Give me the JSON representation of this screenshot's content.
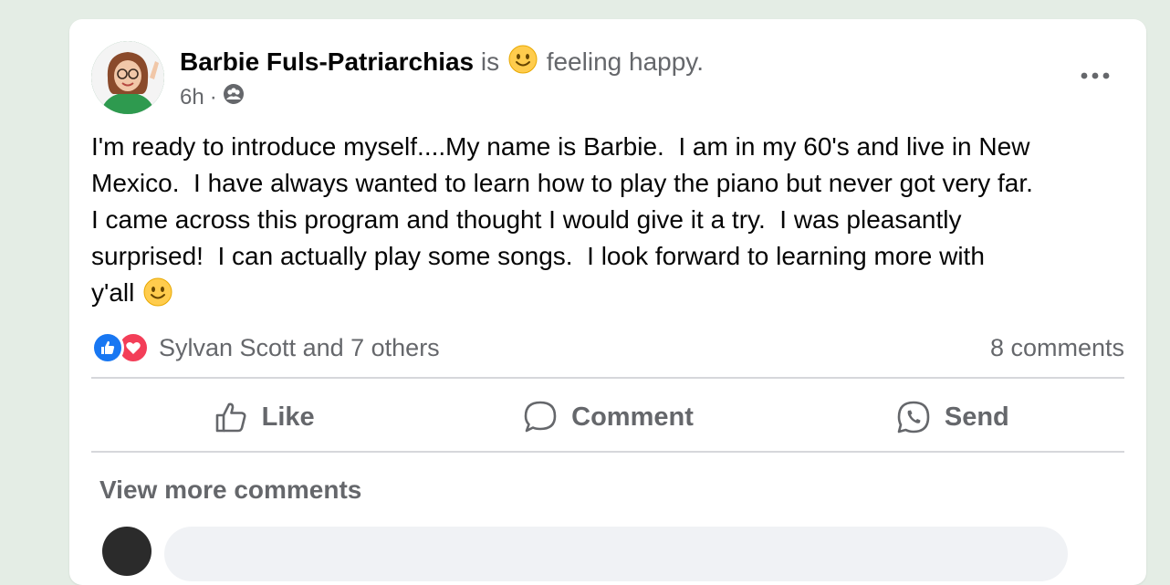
{
  "post": {
    "author": "Barbie Fuls-Patriarchias",
    "feeling_prefix": "is",
    "feeling_text": "feeling happy.",
    "feeling_icon": "smiling-face-icon",
    "timestamp": "6h",
    "separator": "·",
    "audience_icon": "group-icon",
    "body": "I'm ready to introduce myself....My name is Barbie.  I am in my 60's and live in New\nMexico.  I have always wanted to learn how to play the piano but never got very far.\nI came across this program and thought I would give it a try.  I was pleasantly\nsurprised!  I can actually play some songs.  I look forward to learning more with\ny'all"
  },
  "reactions": {
    "types": [
      "like",
      "love"
    ],
    "summary": "Sylvan Scott and 7 others",
    "comments_count": "8 comments"
  },
  "actions": {
    "like": "Like",
    "comment": "Comment",
    "send": "Send"
  },
  "comments": {
    "view_more": "View more comments"
  },
  "colors": {
    "page_bg": "#e4ede5",
    "card_bg": "#ffffff",
    "text_primary": "#050505",
    "text_secondary": "#65676b",
    "like_blue": "#1877f2",
    "love_red": "#f33e58",
    "emoji_yellow": "#ffcc4d"
  }
}
